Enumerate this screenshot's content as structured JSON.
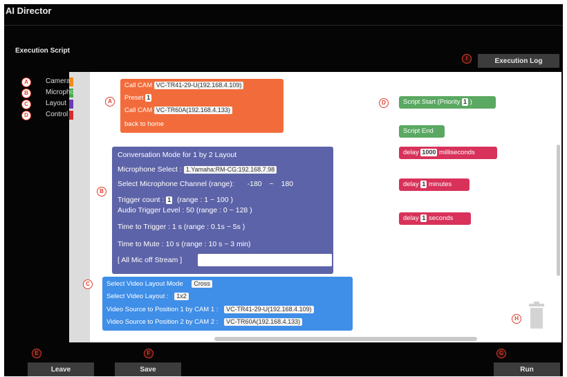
{
  "app_title": "AI Director",
  "section_title": "Execution Script",
  "buttons": {
    "execution_log": "Execution Log",
    "leave": "Leave",
    "save": "Save",
    "run": "Run"
  },
  "badges": {
    "a": "A",
    "b": "B",
    "c": "C",
    "d": "D",
    "e": "E",
    "f": "F",
    "g": "G",
    "h": "H",
    "i": "I"
  },
  "categories": [
    {
      "label": "Camera",
      "color": "#f08a1c"
    },
    {
      "label": "Microphone",
      "color": "#3fae49"
    },
    {
      "label": "Layout",
      "color": "#6a3bb5"
    },
    {
      "label": "Control",
      "color": "#d62b2b"
    }
  ],
  "camera_block": {
    "call_cam_label": "Call CAM",
    "cam1": "VC-TR41-29-U(192.168.4.109)",
    "preset_label": "Preset",
    "preset_value": "1",
    "cam2": "VC-TR60A(192.168.4.133)",
    "back_home": "back to home"
  },
  "conversation_block": {
    "title": "Conversation Mode for 1 by 2 Layout",
    "mic_select_label": "Microphone Select :",
    "mic_select_value": "1.Yamaha:RM-CG:192.168.7.98",
    "mic_channel_label": "Select Microphone Channel (range):",
    "mic_channel_min": "-180",
    "mic_channel_tilde": "~",
    "mic_channel_max": "180",
    "trigger_count_label": "Trigger count :",
    "trigger_count_value": "1",
    "trigger_count_range": "(range :  1  ~  100  )",
    "audio_level": "Audio Trigger Level :   50   (range :   0  ~  128   )",
    "time_trigger": "Time to Trigger :   1  s   (range :  0.1s  ~  5s   )",
    "time_mute": "Time to Mute :   10  s   (range :  10 s  ~  3   min)",
    "all_mic_off": "[ All Mic off Stream ]"
  },
  "layout_block": {
    "mode_label": "Select Video Layout Mode",
    "mode_value": "Cross",
    "layout_label": "Select Video Layout :",
    "layout_value": "1x2",
    "pos1_label": "Video Source to Position  1  by CAM 1 :",
    "pos1_value": "VC-TR41-29-U(192.168.4.109)",
    "pos2_label": "Video Source to Position  2  by CAM 2 :",
    "pos2_value": "VC-TR60A(192.168.4.133)"
  },
  "control_blocks": {
    "script_start_label": "Script Start (Priority",
    "script_start_value": "1",
    "script_start_close": ")",
    "script_end": "Script End",
    "delay_label": "delay",
    "delay_ms_value": "1000",
    "delay_ms_unit": "milliseconds",
    "delay_min_value": "1",
    "delay_min_unit": "minutes",
    "delay_sec_value": "1",
    "delay_sec_unit": "seconds"
  },
  "colors": {
    "camera": "#f26c3b",
    "conversation": "#5d63a8",
    "layout": "#3f8ee8",
    "script": "#5aa862",
    "delay": "#d8325a"
  }
}
